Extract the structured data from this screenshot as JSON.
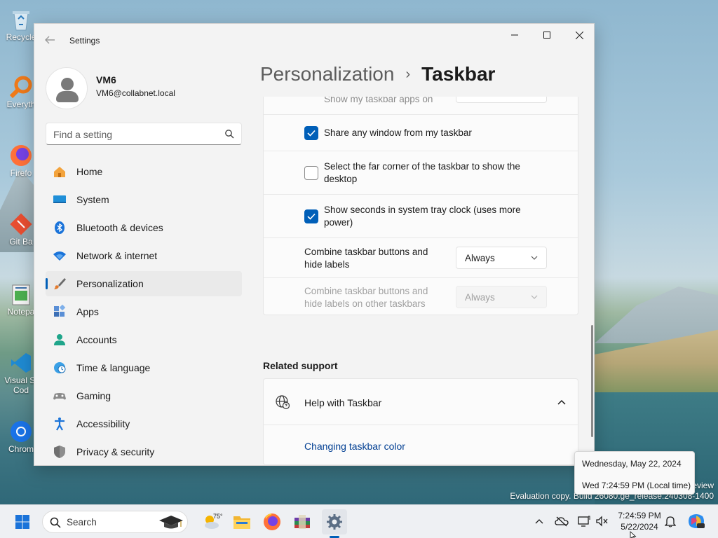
{
  "desktop": {
    "icons": [
      {
        "label": "Recycle",
        "icon": "recycle-bin-icon"
      },
      {
        "label": "Everyth",
        "icon": "everything-icon"
      },
      {
        "label": "Firefo",
        "icon": "firefox-icon"
      },
      {
        "label": "Git Ba",
        "icon": "git-bash-icon"
      },
      {
        "label": "Notepa",
        "icon": "notepad-icon"
      },
      {
        "label": "Visual St",
        "label2": "Cod",
        "icon": "vscode-icon"
      },
      {
        "label": "Chrom",
        "icon": "chrome-icon"
      }
    ],
    "watermark_line1": "eview",
    "watermark_line2": "Evaluation copy. Build 26080.ge_release.240308-1400"
  },
  "window": {
    "app_title": "Settings",
    "controls": {
      "minimize": "—",
      "maximize": "☐",
      "close": "✕"
    }
  },
  "profile": {
    "name": "VM6",
    "email": "VM6@collabnet.local"
  },
  "search": {
    "placeholder": "Find a setting"
  },
  "sidebar": {
    "items": [
      {
        "label": "Home",
        "icon": "home-icon"
      },
      {
        "label": "System",
        "icon": "system-icon"
      },
      {
        "label": "Bluetooth & devices",
        "icon": "bluetooth-icon"
      },
      {
        "label": "Network & internet",
        "icon": "wifi-icon"
      },
      {
        "label": "Personalization",
        "icon": "brush-icon",
        "active": true
      },
      {
        "label": "Apps",
        "icon": "apps-icon"
      },
      {
        "label": "Accounts",
        "icon": "accounts-icon"
      },
      {
        "label": "Time & language",
        "icon": "globe-clock-icon"
      },
      {
        "label": "Gaming",
        "icon": "controller-icon"
      },
      {
        "label": "Accessibility",
        "icon": "accessibility-icon"
      },
      {
        "label": "Privacy & security",
        "icon": "shield-icon"
      }
    ]
  },
  "breadcrumb": {
    "parent": "Personalization",
    "separator": "›",
    "current": "Taskbar"
  },
  "settings": {
    "partial_row": "Show my taskbar apps on",
    "share_window": {
      "label": "Share any window from my taskbar",
      "checked": true
    },
    "far_corner": {
      "label": "Select the far corner of the taskbar to show the desktop",
      "checked": false
    },
    "show_seconds": {
      "label": "Show seconds in system tray clock (uses more power)",
      "checked": true
    },
    "combine_buttons": {
      "label": "Combine taskbar buttons and hide labels",
      "value": "Always"
    },
    "combine_other": {
      "label": "Combine taskbar buttons and hide labels on other taskbars",
      "value": "Always",
      "disabled": true
    }
  },
  "related_support": {
    "title": "Related support",
    "help_label": "Help with Taskbar",
    "link": "Changing taskbar color"
  },
  "tooltip": {
    "date_line": "Wednesday, May 22, 2024",
    "time_line": "Wed 7:24:59 PM (Local time)"
  },
  "taskbar": {
    "search_label": "Search",
    "weather_temp": "75°",
    "clock_time": "7:24:59 PM",
    "clock_date": "5/22/2024"
  },
  "colors": {
    "accent": "#005fb8",
    "link": "#003e92",
    "disabled_text": "#a0a0a0"
  }
}
